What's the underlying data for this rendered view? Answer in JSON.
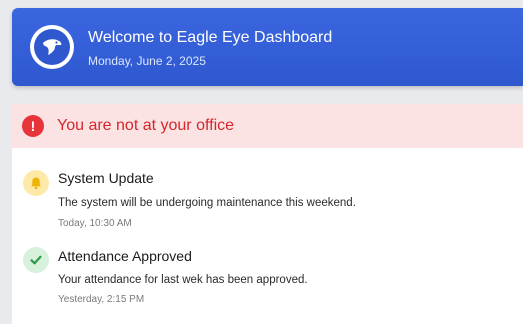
{
  "header": {
    "title": "Welcome to Eagle Eye Dashboard",
    "date": "Monday, June 2, 2025",
    "logo_icon": "eagle-icon"
  },
  "alert": {
    "icon": "exclamation-icon",
    "icon_glyph": "!",
    "text": "You are not at your office",
    "color": "#d6262c"
  },
  "notifications": [
    {
      "icon": "bell-icon",
      "title": "System Update",
      "message": "The system will be undergoing maintenance this weekend.",
      "time": "Today, 10:30 AM",
      "icon_bg": "#fde9a8",
      "icon_color": "#f0b400"
    },
    {
      "icon": "check-icon",
      "title": "Attendance Approved",
      "message": "Your attendance for last wek has been approved.",
      "time": "Yesterday, 2:15 PM",
      "icon_bg": "#d8f1dc",
      "icon_color": "#2e9a45"
    }
  ]
}
